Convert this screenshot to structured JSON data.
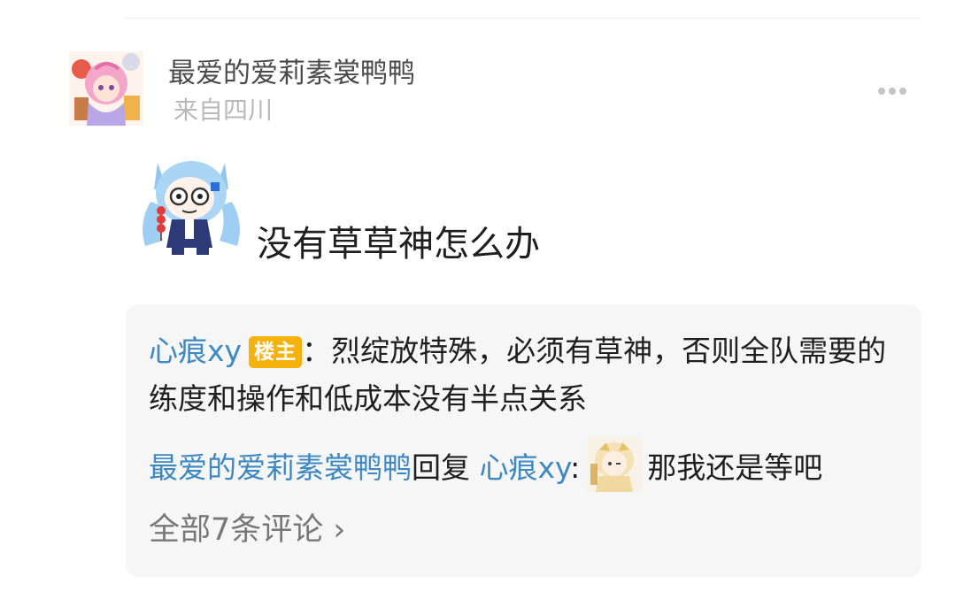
{
  "post": {
    "author_name": "最爱的爱莉素裳鸭鸭",
    "location": "来自四川",
    "content": "没有草草神怎么办"
  },
  "comments": {
    "comment1": {
      "author": "心痕xy",
      "badge": "楼主",
      "separator": "：",
      "text": "烈绽放特殊，必须有草神，否则全队需要的练度和操作和低成本没有半点关系"
    },
    "comment2": {
      "author": "最爱的爱莉素裳鸭鸭",
      "reply_word": "回复",
      "target": "心痕xy",
      "separator": ":",
      "text": "那我还是等吧"
    },
    "all_comments_label": "全部7条评论",
    "chevron": "›"
  },
  "icons": {
    "more": "more-horizontal-icon",
    "chevron": "chevron-right-icon"
  },
  "colors": {
    "link": "#3e88c2",
    "badge": "#f5b10c",
    "location": "#b9b9b9",
    "comment_bg": "#f6f6f6"
  }
}
